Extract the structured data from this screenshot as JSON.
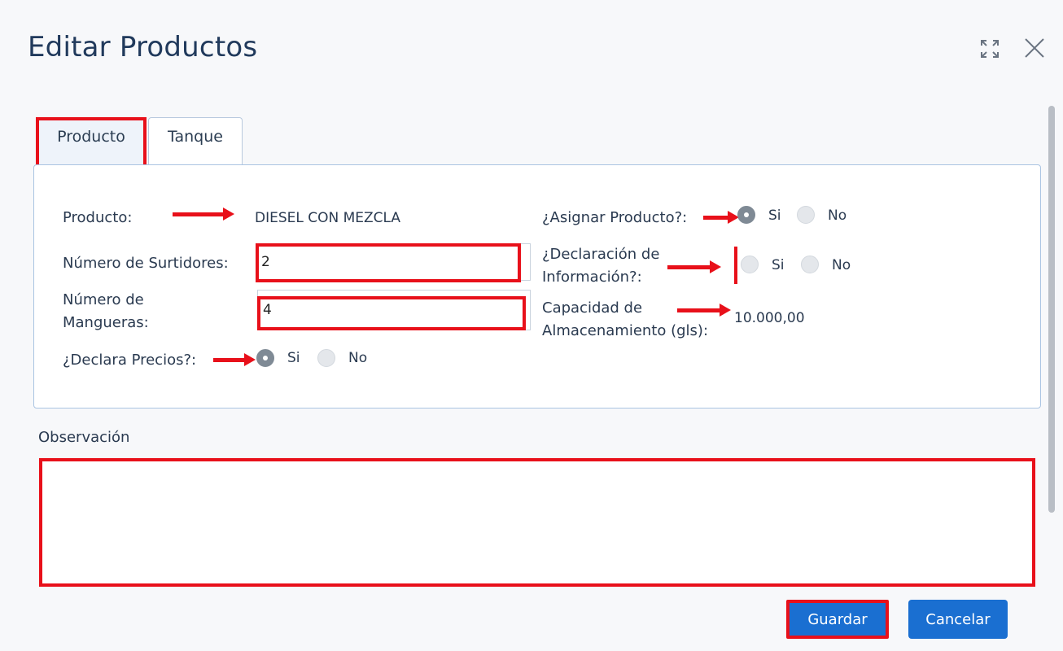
{
  "dialog": {
    "title": "Editar Productos"
  },
  "header_icons": [
    "expand-icon",
    "close-icon"
  ],
  "tabs": [
    {
      "label": "Producto",
      "active": true
    },
    {
      "label": "Tanque",
      "active": false
    }
  ],
  "form": {
    "producto": {
      "label": "Producto:",
      "value": "DIESEL CON MEZCLA"
    },
    "surtidores": {
      "label": "Número de Surtidores:",
      "value": "2"
    },
    "mangueras": {
      "label_line1": "Número de",
      "label_line2": "Mangueras:",
      "value": "4"
    },
    "declara_precios": {
      "label": "¿Declara Precios?:",
      "yes": "Si",
      "no": "No",
      "selected": "Si"
    },
    "asignar_producto": {
      "label": "¿Asignar Producto?:",
      "yes": "Si",
      "no": "No",
      "selected": "Si"
    },
    "declaracion_info": {
      "label_line1": "¿Declaración de",
      "label_line2": "Información?:",
      "yes": "Si",
      "no": "No",
      "selected": ""
    },
    "capacidad": {
      "label_line1": "Capacidad de",
      "label_line2": "Almacenamiento (gls):",
      "value": "10.000,00"
    }
  },
  "observacion": {
    "label": "Observación",
    "value": ""
  },
  "buttons": {
    "save": "Guardar",
    "cancel": "Cancelar"
  },
  "colors": {
    "primary": "#1a6fd1",
    "annotation_red": "#e8101a",
    "panel_border": "#aac4e2"
  }
}
